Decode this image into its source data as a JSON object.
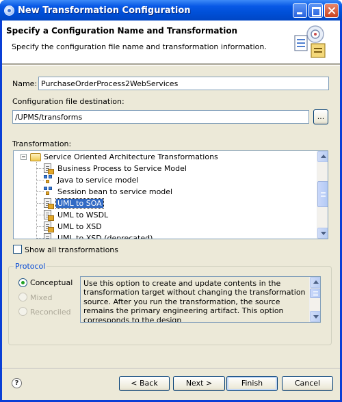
{
  "window": {
    "title": "New Transformation Configuration"
  },
  "banner": {
    "title": "Specify a Configuration Name and Transformation",
    "description": "Specify the configuration file name and transformation information."
  },
  "form": {
    "name_label": "Name:",
    "name_value": "PurchaseOrderProcess2WebServices",
    "destination_label": "Configuration file destination:",
    "destination_value": "/UPMS/transforms",
    "browse_label": "...",
    "transformation_label": "Transformation:",
    "show_all_label": "Show all transformations"
  },
  "tree": {
    "category": "Service Oriented Architecture Transformations",
    "items": [
      {
        "label": "Business Process to Service Model",
        "icon": "document-icon",
        "selected": false
      },
      {
        "label": "Java to service model",
        "icon": "model-icon",
        "selected": false
      },
      {
        "label": "Session bean to service model",
        "icon": "model-icon",
        "selected": false
      },
      {
        "label": "UML to SOA",
        "icon": "document-icon",
        "selected": true
      },
      {
        "label": "UML to WSDL",
        "icon": "document-icon",
        "selected": false
      },
      {
        "label": "UML to XSD",
        "icon": "document-icon",
        "selected": false
      },
      {
        "label": "UML to XSD (deprecated)",
        "icon": "document-icon",
        "selected": false
      }
    ]
  },
  "protocol": {
    "legend": "Protocol",
    "options": [
      {
        "label": "Conceptual",
        "checked": true,
        "enabled": true
      },
      {
        "label": "Mixed",
        "checked": false,
        "enabled": false
      },
      {
        "label": "Reconciled",
        "checked": false,
        "enabled": false
      }
    ],
    "description": "Use this option to create and update contents in the transformation target without changing the transformation source. After you run the transformation, the source remains the primary engineering artifact. This option corresponds to the design"
  },
  "buttons": {
    "back": "< Back",
    "next": "Next >",
    "finish": "Finish",
    "cancel": "Cancel"
  },
  "help": {
    "glyph": "?"
  },
  "colors": {
    "titlebar": "#0050d8",
    "selection": "#316ac5",
    "dialog_background": "#ece9d8",
    "group_legend": "#0046d5",
    "radio_checked": "#21a121"
  }
}
